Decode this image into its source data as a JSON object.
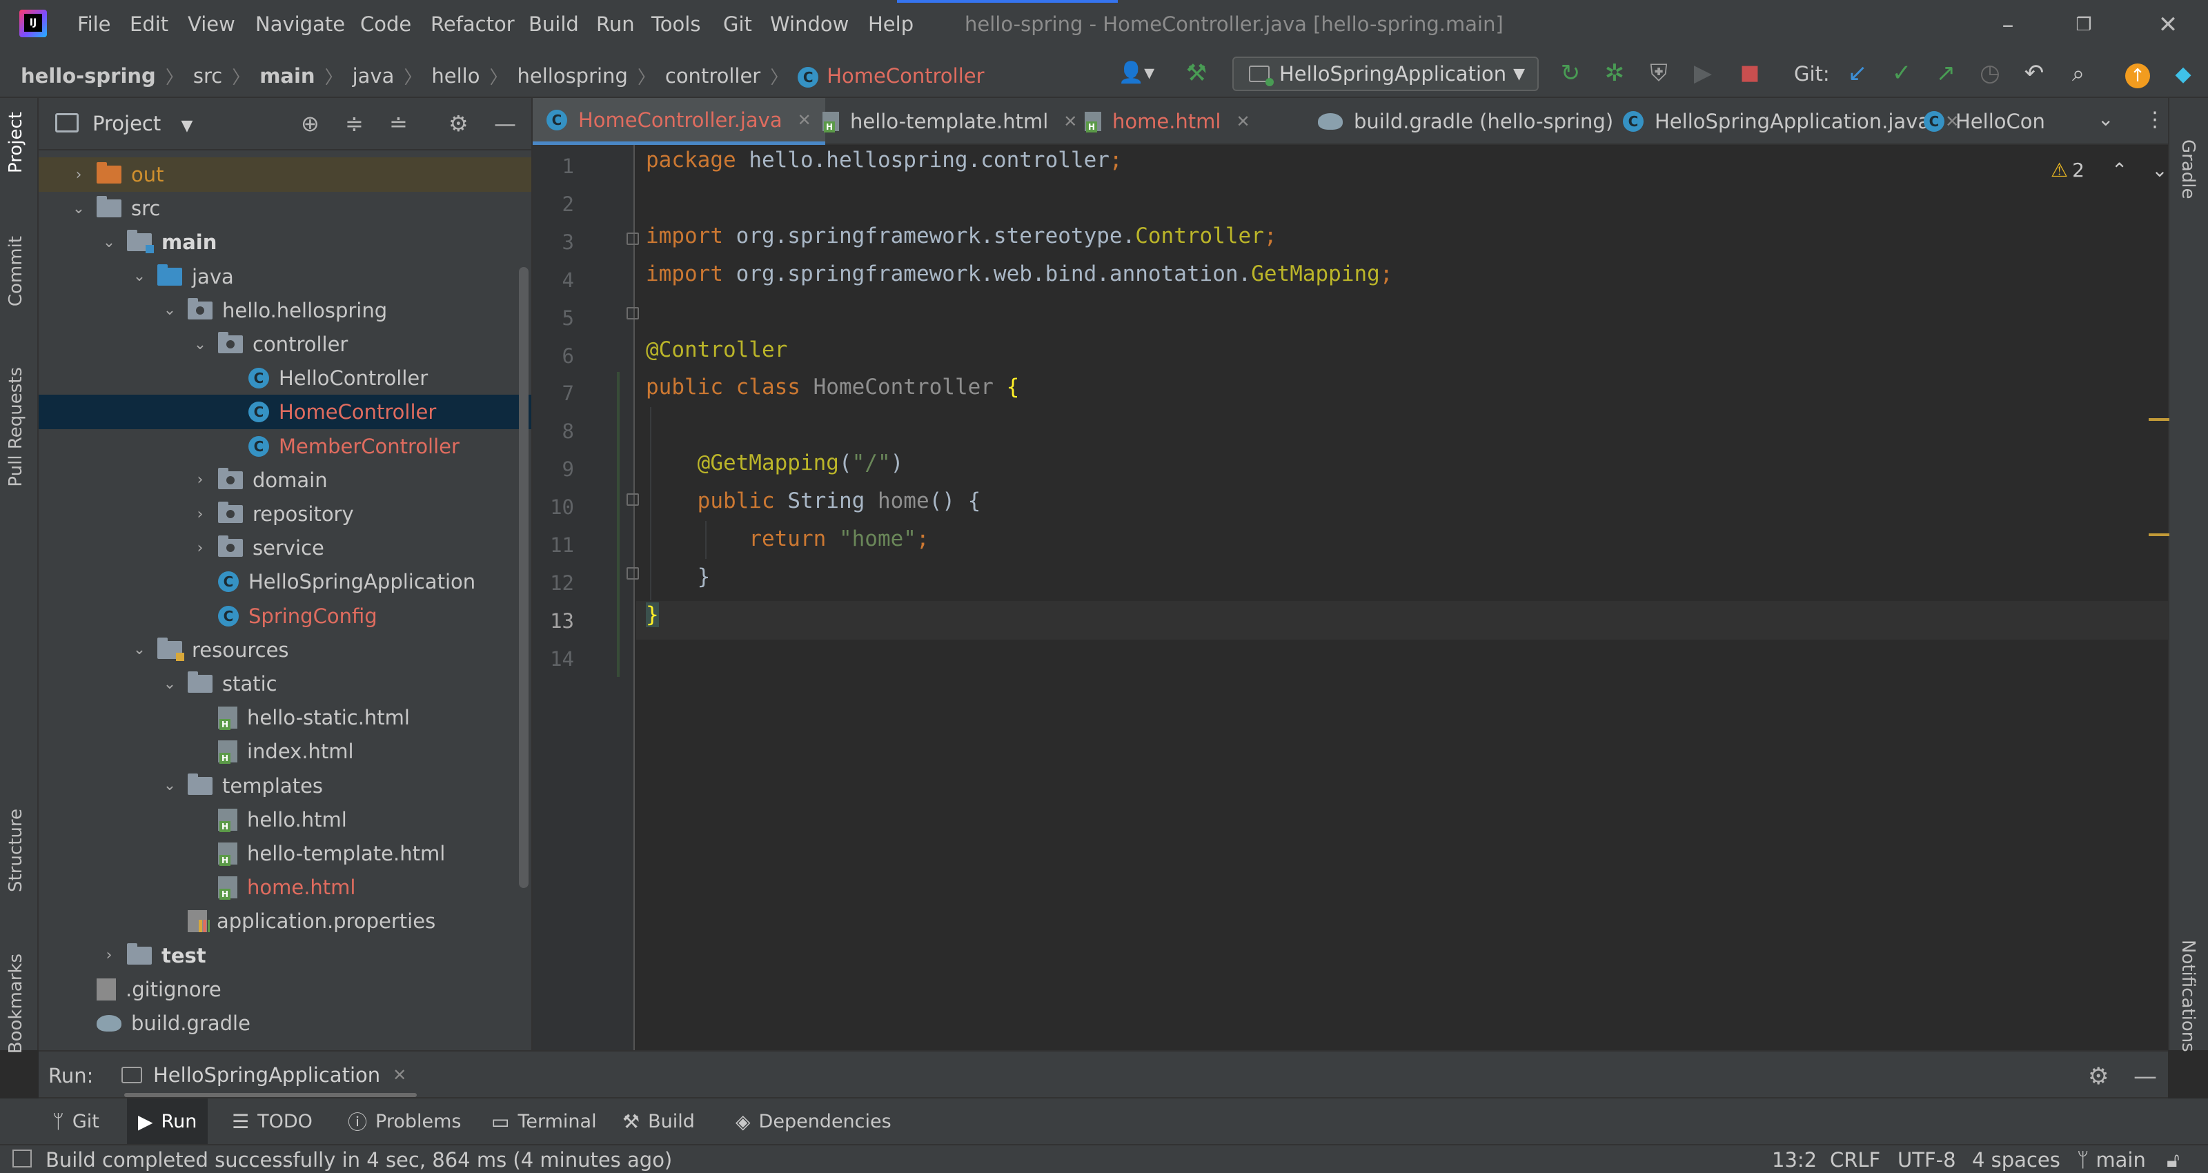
{
  "app": {
    "window_title": "hello-spring - HomeController.java [hello-spring.main]"
  },
  "menu": [
    "File",
    "Edit",
    "View",
    "Navigate",
    "Code",
    "Refactor",
    "Build",
    "Run",
    "Tools",
    "Git",
    "Window",
    "Help"
  ],
  "breadcrumb": [
    "hello-spring",
    "src",
    "main",
    "java",
    "hello",
    "hellospring",
    "controller",
    "HomeController"
  ],
  "toolbar": {
    "run_config": "HelloSpringApplication",
    "git_label": "Git:"
  },
  "left_stripe": [
    "Project",
    "Commit",
    "Pull Requests",
    "Structure",
    "Bookmarks"
  ],
  "right_stripe": [
    "Gradle",
    "Notifications"
  ],
  "project_panel": {
    "title": "Project",
    "tree": [
      {
        "label": "out",
        "depth": 1,
        "arrow": "right",
        "icon": "folder-orange",
        "style": "orange",
        "row": "excluded"
      },
      {
        "label": "src",
        "depth": 1,
        "arrow": "down",
        "icon": "folder",
        "style": ""
      },
      {
        "label": "main",
        "depth": 2,
        "arrow": "down",
        "icon": "folder-main",
        "style": "bold"
      },
      {
        "label": "java",
        "depth": 3,
        "arrow": "down",
        "icon": "folder-blue",
        "style": ""
      },
      {
        "label": "hello.hellospring",
        "depth": 4,
        "arrow": "down",
        "icon": "folder-package",
        "style": ""
      },
      {
        "label": "controller",
        "depth": 5,
        "arrow": "down",
        "icon": "folder-package",
        "style": ""
      },
      {
        "label": "HelloController",
        "depth": 6,
        "arrow": "",
        "icon": "class",
        "style": ""
      },
      {
        "label": "HomeController",
        "depth": 6,
        "arrow": "",
        "icon": "class",
        "style": "red",
        "row": "selected"
      },
      {
        "label": "MemberController",
        "depth": 6,
        "arrow": "",
        "icon": "class",
        "style": "red"
      },
      {
        "label": "domain",
        "depth": 5,
        "arrow": "right",
        "icon": "folder-package",
        "style": ""
      },
      {
        "label": "repository",
        "depth": 5,
        "arrow": "right",
        "icon": "folder-package",
        "style": ""
      },
      {
        "label": "service",
        "depth": 5,
        "arrow": "right",
        "icon": "folder-package",
        "style": ""
      },
      {
        "label": "HelloSpringApplication",
        "depth": 5,
        "arrow": "",
        "icon": "class-app",
        "style": ""
      },
      {
        "label": "SpringConfig",
        "depth": 5,
        "arrow": "",
        "icon": "class",
        "style": "red"
      },
      {
        "label": "resources",
        "depth": 3,
        "arrow": "down",
        "icon": "folder-resources",
        "style": ""
      },
      {
        "label": "static",
        "depth": 4,
        "arrow": "down",
        "icon": "folder",
        "style": ""
      },
      {
        "label": "hello-static.html",
        "depth": 5,
        "arrow": "",
        "icon": "html",
        "style": ""
      },
      {
        "label": "index.html",
        "depth": 5,
        "arrow": "",
        "icon": "html",
        "style": ""
      },
      {
        "label": "templates",
        "depth": 4,
        "arrow": "down",
        "icon": "folder",
        "style": ""
      },
      {
        "label": "hello.html",
        "depth": 5,
        "arrow": "",
        "icon": "html",
        "style": ""
      },
      {
        "label": "hello-template.html",
        "depth": 5,
        "arrow": "",
        "icon": "html",
        "style": ""
      },
      {
        "label": "home.html",
        "depth": 5,
        "arrow": "",
        "icon": "html",
        "style": "red"
      },
      {
        "label": "application.properties",
        "depth": 4,
        "arrow": "",
        "icon": "properties",
        "style": ""
      },
      {
        "label": "test",
        "depth": 2,
        "arrow": "right",
        "icon": "folder",
        "style": "bold"
      },
      {
        "label": ".gitignore",
        "depth": 1,
        "arrow": "",
        "icon": "file",
        "style": ""
      },
      {
        "label": "build.gradle",
        "depth": 1,
        "arrow": "",
        "icon": "gradle",
        "style": ""
      }
    ]
  },
  "editor_tabs": [
    {
      "label": "HomeController.java",
      "icon": "class",
      "active": true,
      "closable": true
    },
    {
      "label": "hello-template.html",
      "icon": "html",
      "active": false,
      "closable": true
    },
    {
      "label": "home.html",
      "icon": "html",
      "active": false,
      "closable": true,
      "style": "red"
    },
    {
      "label": "build.gradle (hello-spring)",
      "icon": "gradle",
      "active": false,
      "closable": true
    },
    {
      "label": "HelloSpringApplication.java",
      "icon": "class-app",
      "active": false,
      "closable": true
    },
    {
      "label": "HelloCon",
      "icon": "class",
      "active": false,
      "closable": false
    }
  ],
  "editor": {
    "line_numbers": [
      "1",
      "2",
      "3",
      "4",
      "5",
      "6",
      "7",
      "8",
      "9",
      "10",
      "11",
      "12",
      "13",
      "14"
    ],
    "current_line": 13,
    "warnings_count": "2",
    "lines": [
      [
        [
          "kw",
          "package "
        ],
        [
          "",
          "hello.hellospring.controller"
        ],
        [
          "kw",
          ";"
        ]
      ],
      [],
      [
        [
          "kw",
          "import "
        ],
        [
          "",
          "org.springframework.stereotype."
        ],
        [
          "ann",
          "Controller"
        ],
        [
          "kw",
          ";"
        ]
      ],
      [
        [
          "kw",
          "import "
        ],
        [
          "",
          "org.springframework.web.bind.annotation."
        ],
        [
          "ann",
          "GetMapping"
        ],
        [
          "kw",
          ";"
        ]
      ],
      [],
      [
        [
          "ann",
          "@Controller"
        ]
      ],
      [
        [
          "kw",
          "public class "
        ],
        [
          "gray",
          "HomeController "
        ],
        [
          "brace",
          "{"
        ]
      ],
      [],
      [
        [
          "",
          "    "
        ],
        [
          "ann",
          "@GetMapping"
        ],
        [
          "",
          "("
        ],
        [
          "str",
          "\"/\""
        ],
        [
          "",
          ")"
        ]
      ],
      [
        [
          "",
          "    "
        ],
        [
          "kw",
          "public "
        ],
        [
          "",
          "String "
        ],
        [
          "gray",
          "home"
        ],
        [
          "",
          "() {"
        ]
      ],
      [
        [
          "",
          "        "
        ],
        [
          "kw",
          "return "
        ],
        [
          "str",
          "\"home\""
        ],
        [
          "kw",
          ";"
        ]
      ],
      [
        [
          "",
          "    }"
        ]
      ],
      [
        [
          "caret",
          "}"
        ]
      ],
      []
    ]
  },
  "run_panel": {
    "label": "Run:",
    "tab": "HelloSpringApplication"
  },
  "bottom_tabs": [
    {
      "label": "Git",
      "icon": "git-branch-icon"
    },
    {
      "label": "Run",
      "icon": "play-icon",
      "active": true
    },
    {
      "label": "TODO",
      "icon": "list-icon"
    },
    {
      "label": "Problems",
      "icon": "info-icon"
    },
    {
      "label": "Terminal",
      "icon": "terminal-icon"
    },
    {
      "label": "Build",
      "icon": "hammer-icon"
    },
    {
      "label": "Dependencies",
      "icon": "layers-icon"
    }
  ],
  "status": {
    "message": "Build completed successfully in 4 sec, 864 ms (4 minutes ago)",
    "position": "13:2",
    "line_sep": "CRLF",
    "encoding": "UTF-8",
    "indent": "4 spaces",
    "branch": "main"
  },
  "colors": {
    "keyword": "#cc7832",
    "annotation": "#bbb529",
    "string": "#6a8759",
    "modified_file": "#e06c5f",
    "selection": "#0d293e",
    "accent": "#4a88c7"
  }
}
